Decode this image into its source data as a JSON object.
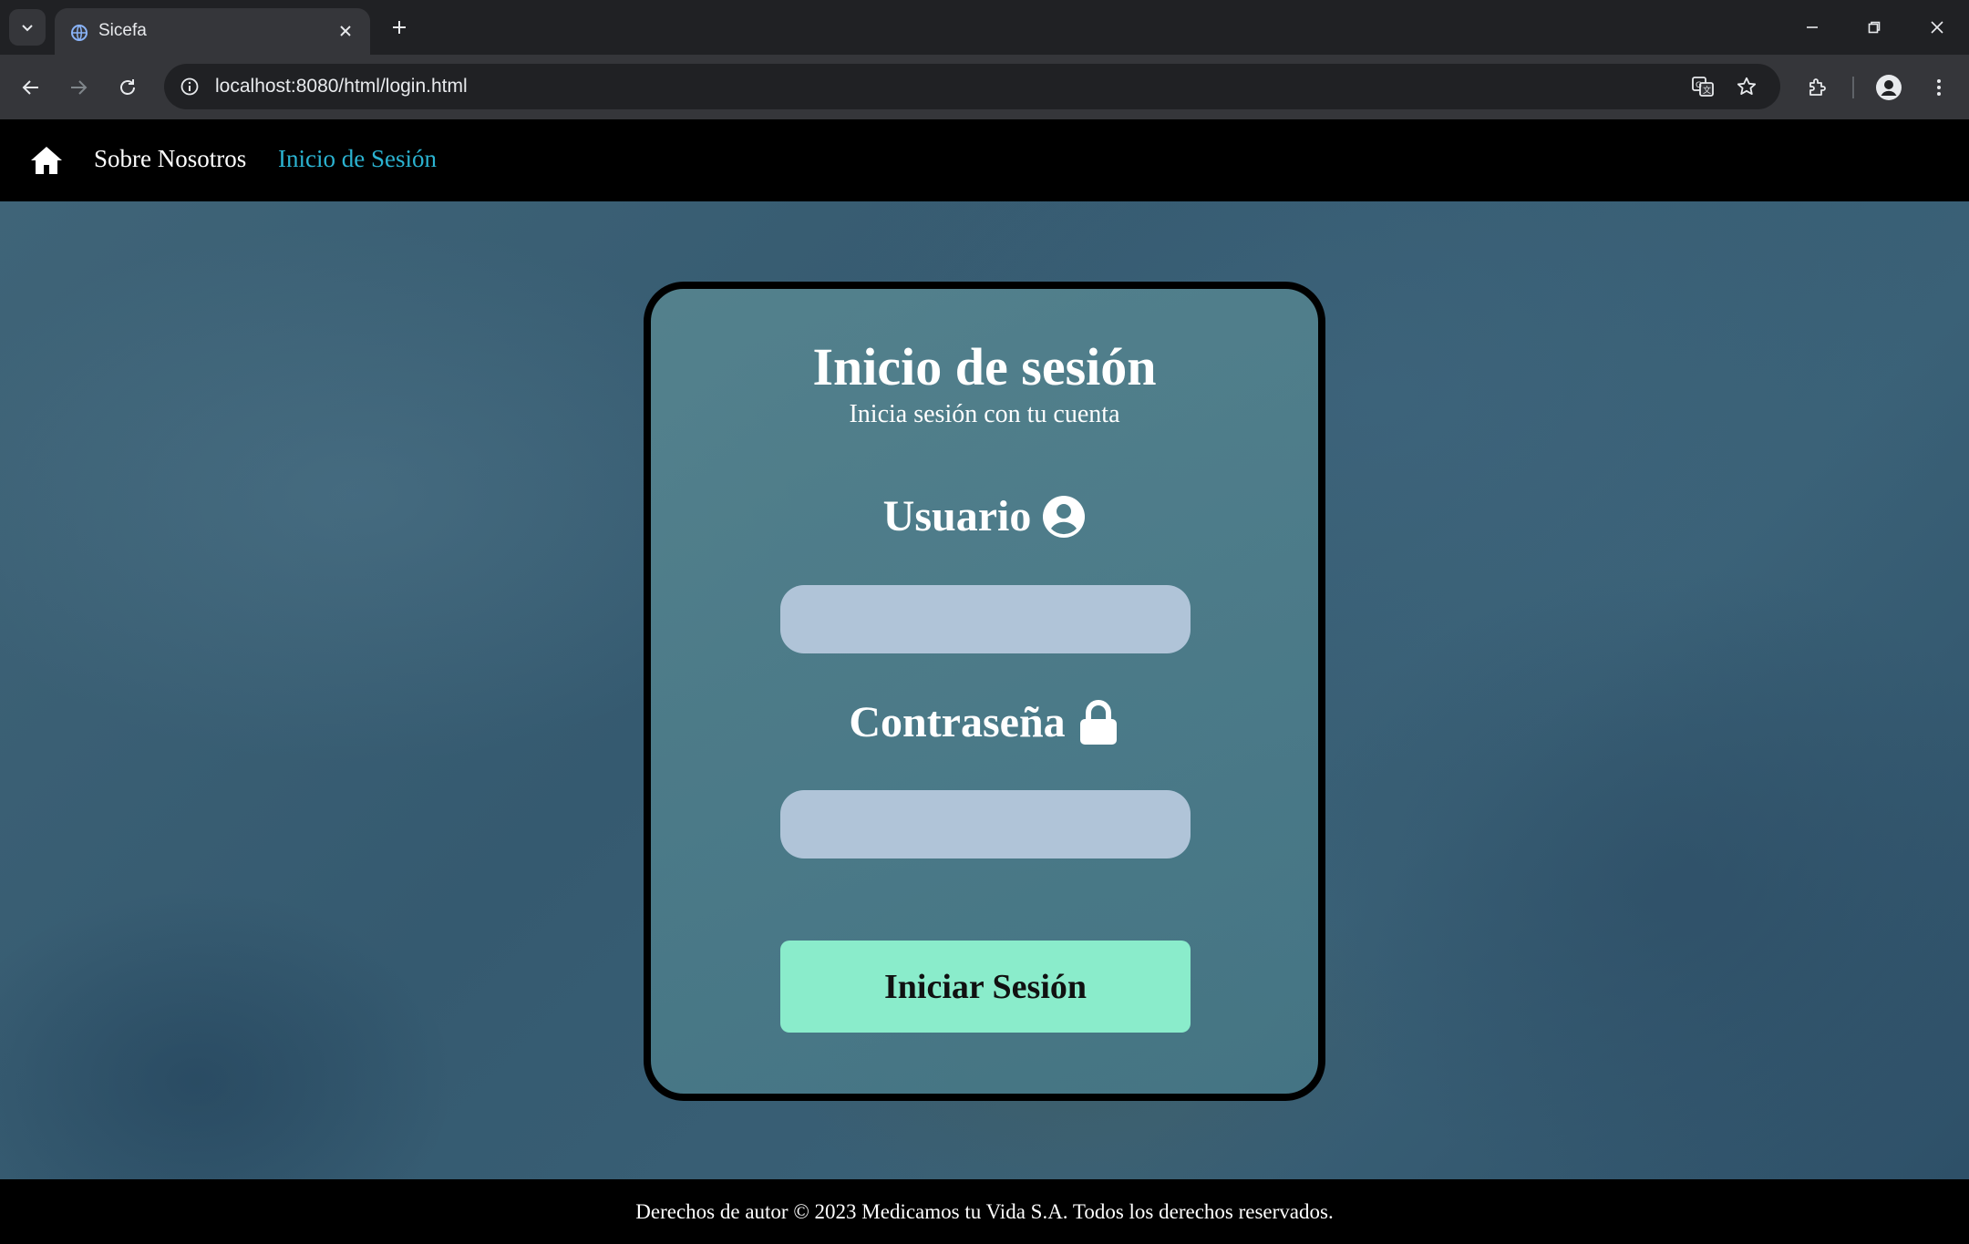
{
  "browser": {
    "tab_title": "Sicefa",
    "url": "localhost:8080/html/login.html"
  },
  "navbar": {
    "home_icon": "home-icon",
    "links": [
      {
        "label": "Sobre Nosotros",
        "color": "#ffffff"
      },
      {
        "label": "Inicio de Sesión",
        "color": "#2bb3d1",
        "active": true
      }
    ]
  },
  "login": {
    "title": "Inicio de sesión",
    "subtitle": "Inicia sesión con tu cuenta",
    "user_label": "Usuario",
    "user_icon": "user-circle-icon",
    "user_value": "",
    "password_label": "Contraseña",
    "password_icon": "lock-icon",
    "password_value": "",
    "submit_label": "Iniciar Sesión",
    "colors": {
      "input_bg": "#b0c4d8",
      "button_bg": "#8aeccb"
    }
  },
  "footer": {
    "text": "Derechos de autor © 2023 Medicamos tu Vida S.A. Todos los derechos reservados."
  }
}
